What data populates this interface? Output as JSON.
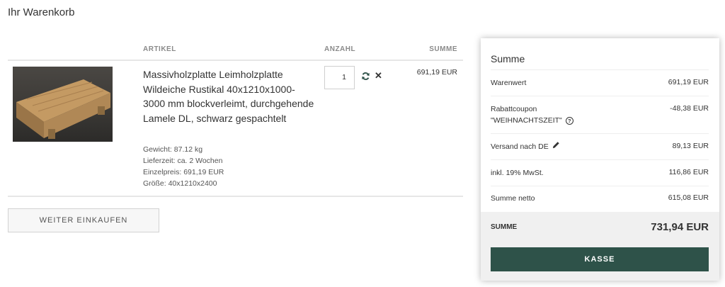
{
  "page": {
    "title": "Ihr Warenkorb"
  },
  "table": {
    "headers": {
      "article": "ARTIKEL",
      "quantity": "ANZAHL",
      "sum": "SUMME"
    },
    "item": {
      "title": "Massivholzplatte Leimholzplatte Wildeiche Rustikal 40x1210x1000-3000 mm blockverleimt, durchgehende Lamele DL, schwarz gespachtelt",
      "meta": [
        "Gewicht: 87.12 kg",
        "Lieferzeit: ca. 2 Wochen",
        "Einzelpreis: 691,19 EUR",
        "Größe: 40x1210x2400"
      ],
      "quantity": "1",
      "total": "691,19 EUR",
      "remove_symbol": "✕"
    }
  },
  "continue_label": "WEITER EINKAUFEN",
  "summary": {
    "title": "Summe",
    "rows": [
      {
        "label": "Warenwert",
        "value": "691,19 EUR"
      },
      {
        "label": "Rabattcoupon",
        "label2": "\"WEIHNACHTSZEIT\"",
        "value": "-48,38 EUR"
      },
      {
        "label": "Versand nach DE",
        "value": "89,13 EUR"
      },
      {
        "label": "inkl. 19% MwSt.",
        "value": "116,86 EUR"
      },
      {
        "label": "Summe netto",
        "value": "615,08 EUR"
      }
    ],
    "total_label": "SUMME",
    "total_value": "731,94 EUR",
    "checkout_label": "KASSE",
    "info_symbol": "?"
  },
  "colors": {
    "accent": "#2e5249",
    "refresh_icon": "#2e5249",
    "total_band": "#f0f0f0"
  },
  "icons": {
    "refresh": "refresh-icon",
    "remove": "close-icon",
    "info": "info-icon",
    "edit": "pencil-icon"
  }
}
